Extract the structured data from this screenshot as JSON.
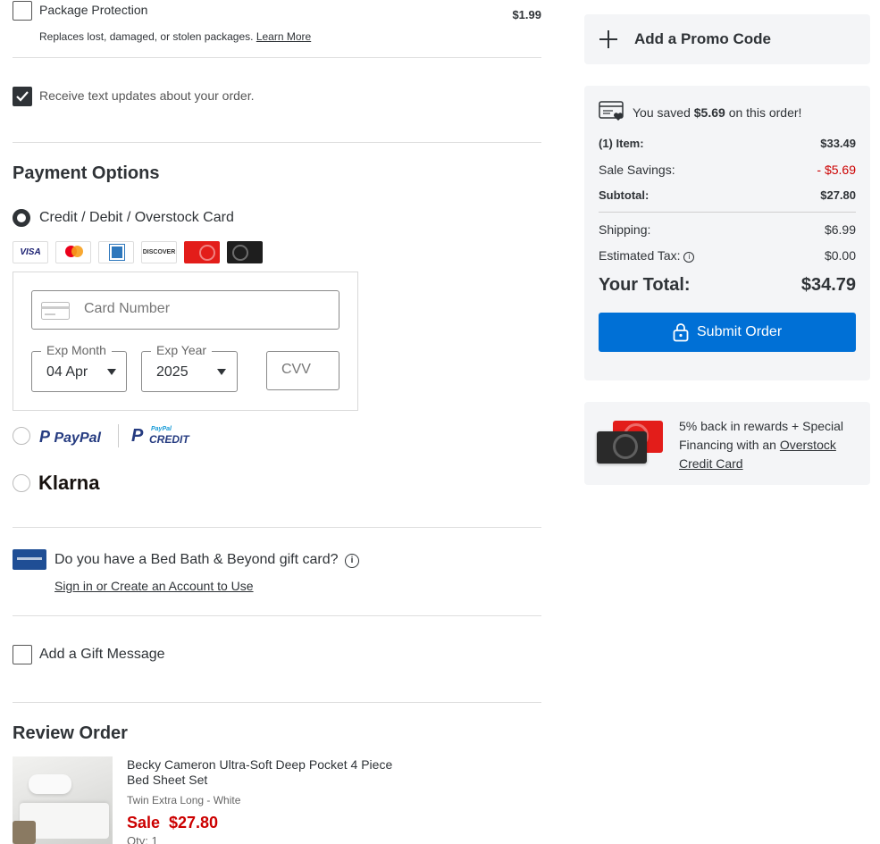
{
  "package_protection": {
    "label": "Package Protection",
    "price": "$1.99",
    "description": "Replaces lost, damaged, or stolen packages.",
    "learn_more": "Learn More"
  },
  "text_updates": {
    "label": "Receive text updates about your order.",
    "checked": true
  },
  "payment": {
    "heading": "Payment Options",
    "credit_option": "Credit / Debit / Overstock Card",
    "card_logos": [
      "visa-logo",
      "mastercard-logo",
      "amex-logo",
      "discover-logo",
      "overstock-red-card-logo",
      "overstock-black-card-logo"
    ],
    "visa_text": "VISA",
    "discover_text": "DISCOVER",
    "card_number_placeholder": "Card Number",
    "exp_month_label": "Exp Month",
    "exp_month_value": "04 Apr",
    "exp_year_label": "Exp Year",
    "exp_year_value": "2025",
    "cvv_placeholder": "CVV",
    "paypal": "PayPal",
    "paypal_credit_small": "PayPal",
    "paypal_credit": "CREDIT",
    "klarna": "Klarna"
  },
  "gift_card": {
    "question": "Do you have a Bed Bath & Beyond gift card?",
    "link": "Sign in or Create an Account to Use"
  },
  "gift_message": {
    "label": "Add a Gift Message",
    "checked": false
  },
  "review": {
    "heading": "Review Order",
    "item": {
      "title_line1": "Becky Cameron Ultra-Soft Deep Pocket 4 Piece",
      "title_line2": "Bed Sheet Set",
      "variant": "Twin Extra Long - White",
      "sale_label": "Sale",
      "sale_price": "$27.80",
      "qty": "Qty: 1"
    }
  },
  "promo": {
    "label": "Add a Promo Code"
  },
  "summary": {
    "saved_prefix": "You saved",
    "saved_amount": "$5.69",
    "saved_suffix": "on this order!",
    "items_label": "(1) Item:",
    "items_value": "$33.49",
    "savings_label": "Sale Savings:",
    "savings_value": "- $5.69",
    "subtotal_label": "Subtotal:",
    "subtotal_value": "$27.80",
    "shipping_label": "Shipping:",
    "shipping_value": "$6.99",
    "tax_label": "Estimated Tax:",
    "tax_value": "$0.00",
    "total_label": "Your Total:",
    "total_value": "$34.79",
    "submit_label": "Submit Order"
  },
  "rewards": {
    "text_line1": "5% back in rewards + Special",
    "text_line2_prefix": "Financing with an",
    "link_line1": "Overstock",
    "link_line2": "Credit Card"
  },
  "colors": {
    "accent_blue": "#0070d6",
    "sale_red": "#cc0000",
    "text_dark": "#2f3337",
    "panel_bg": "#f4f5f7"
  }
}
